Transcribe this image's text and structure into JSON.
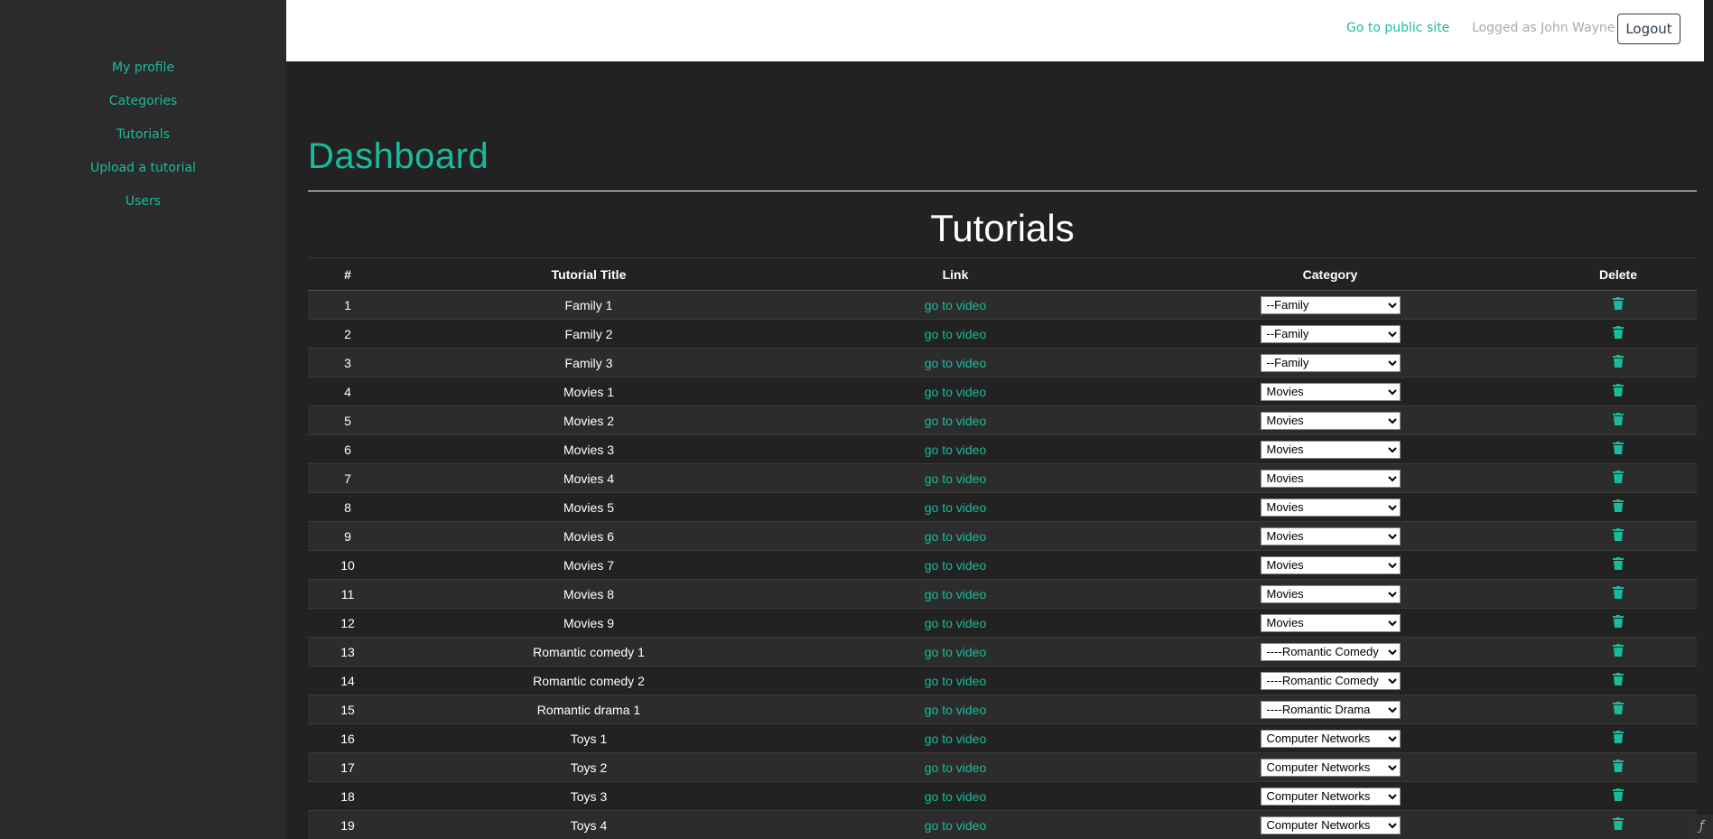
{
  "sidebar": {
    "items": [
      {
        "label": "My profile"
      },
      {
        "label": "Categories"
      },
      {
        "label": "Tutorials"
      },
      {
        "label": "Upload a tutorial"
      },
      {
        "label": "Users"
      }
    ]
  },
  "header": {
    "public_link": "Go to public site",
    "logged_as": "Logged as John Wayne",
    "logout_label": "Logout"
  },
  "main": {
    "title": "Dashboard",
    "section_title": "Tutorials"
  },
  "table": {
    "columns": [
      "#",
      "Tutorial Title",
      "Link",
      "Category",
      "Delete"
    ],
    "rows": [
      {
        "num": "1",
        "title": "Family 1",
        "link": "go to video",
        "category": "--Family"
      },
      {
        "num": "2",
        "title": "Family 2",
        "link": "go to video",
        "category": "--Family"
      },
      {
        "num": "3",
        "title": "Family 3",
        "link": "go to video",
        "category": "--Family"
      },
      {
        "num": "4",
        "title": "Movies 1",
        "link": "go to video",
        "category": "Movies"
      },
      {
        "num": "5",
        "title": "Movies 2",
        "link": "go to video",
        "category": "Movies"
      },
      {
        "num": "6",
        "title": "Movies 3",
        "link": "go to video",
        "category": "Movies"
      },
      {
        "num": "7",
        "title": "Movies 4",
        "link": "go to video",
        "category": "Movies"
      },
      {
        "num": "8",
        "title": "Movies 5",
        "link": "go to video",
        "category": "Movies"
      },
      {
        "num": "9",
        "title": "Movies 6",
        "link": "go to video",
        "category": "Movies"
      },
      {
        "num": "10",
        "title": "Movies 7",
        "link": "go to video",
        "category": "Movies"
      },
      {
        "num": "11",
        "title": "Movies 8",
        "link": "go to video",
        "category": "Movies"
      },
      {
        "num": "12",
        "title": "Movies 9",
        "link": "go to video",
        "category": "Movies"
      },
      {
        "num": "13",
        "title": "Romantic comedy 1",
        "link": "go to video",
        "category": "----Romantic Comedy"
      },
      {
        "num": "14",
        "title": "Romantic comedy 2",
        "link": "go to video",
        "category": "----Romantic Comedy"
      },
      {
        "num": "15",
        "title": "Romantic drama 1",
        "link": "go to video",
        "category": "----Romantic Drama"
      },
      {
        "num": "16",
        "title": "Toys 1",
        "link": "go to video",
        "category": "Computer Networks"
      },
      {
        "num": "17",
        "title": "Toys 2",
        "link": "go to video",
        "category": "Computer Networks"
      },
      {
        "num": "18",
        "title": "Toys 3",
        "link": "go to video",
        "category": "Computer Networks"
      },
      {
        "num": "19",
        "title": "Toys 4",
        "link": "go to video",
        "category": "Computer Networks"
      }
    ]
  },
  "icons": {
    "delete": "trash-icon",
    "framework_badge": "symfony-icon"
  },
  "colors": {
    "accent": "#18bc9c",
    "background": "#222222",
    "sidebar": "#2b2b2b",
    "header": "#ffffff"
  }
}
